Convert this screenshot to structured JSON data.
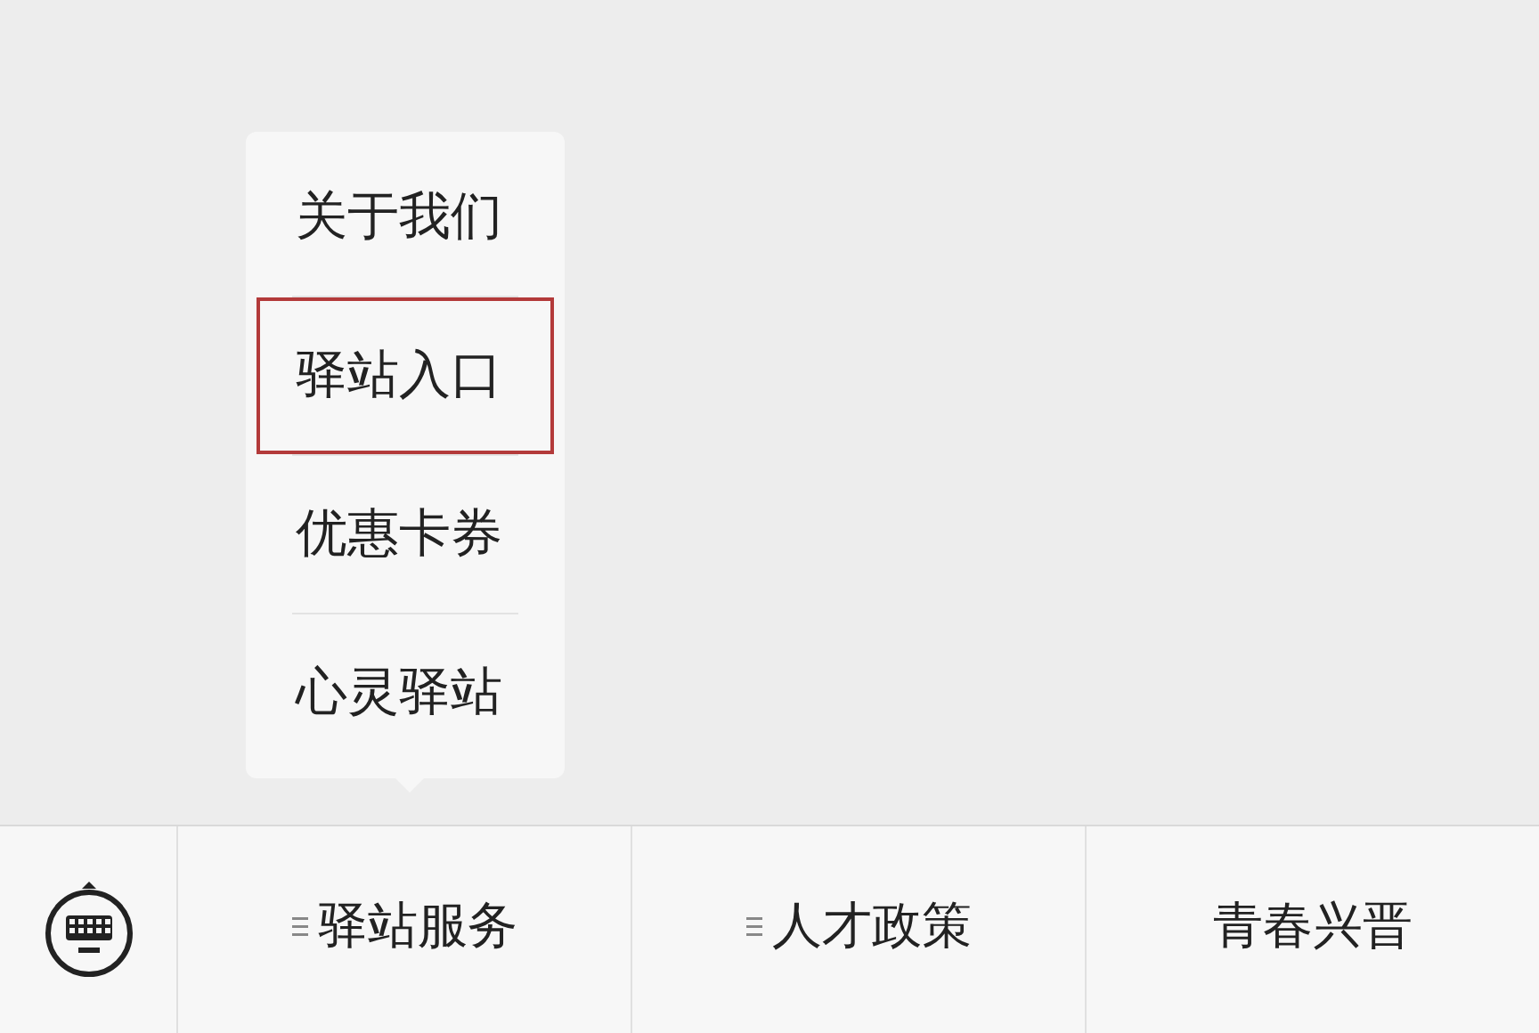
{
  "submenu": {
    "items": [
      {
        "label": "关于我们",
        "selected": false
      },
      {
        "label": "驿站入口",
        "selected": true
      },
      {
        "label": "优惠卡券",
        "selected": false
      },
      {
        "label": "心灵驿站",
        "selected": false
      }
    ]
  },
  "menu_bar": {
    "tabs": [
      {
        "label": "驿站服务",
        "has_submenu": true
      },
      {
        "label": "人才政策",
        "has_submenu": true
      },
      {
        "label": "青春兴晋",
        "has_submenu": false
      }
    ]
  }
}
